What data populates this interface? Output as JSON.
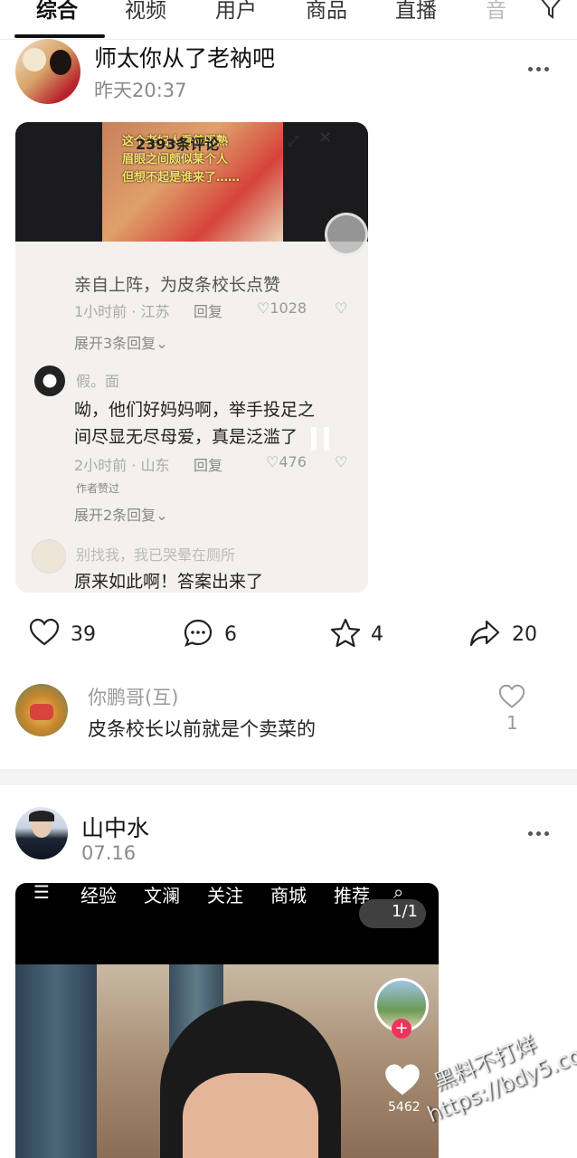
{
  "tabs": [
    {
      "label": "综合",
      "active": true
    },
    {
      "label": "视频"
    },
    {
      "label": "用户"
    },
    {
      "label": "商品"
    },
    {
      "label": "直播"
    },
    {
      "label": "音"
    }
  ],
  "post1": {
    "username": "师太你从了老衲吧",
    "time": "昨天20:37",
    "video_captions": [
      "这个老妇人看着眼熟",
      "眉眼之间颇似某个人",
      "但想不起是谁来了……"
    ],
    "panel_title": "2393条评论",
    "comments": [
      {
        "text": "亲自上阵，为皮条校长点赞",
        "time_location": "1小时前 · 江苏",
        "reply_label": "回复",
        "likes": "1028",
        "expand": "展开3条回复"
      },
      {
        "name": "假。面",
        "text_line1": "呦，他们好妈妈啊，举手投足之",
        "text_line2": "间尽显无尽母爱，真是泛滥了",
        "time_location": "2小时前 · 山东",
        "reply_label": "回复",
        "likes": "476",
        "author_liked": "作者赞过",
        "expand": "展开2条回复"
      },
      {
        "name": "别找我，我已哭晕在厕所",
        "text": "原来如此啊！答案出来了"
      }
    ],
    "actions": {
      "likes": "39",
      "comments": "6",
      "favorites": "4",
      "shares": "20"
    },
    "preview_comment": {
      "name": "你鹏哥(互)",
      "text": "皮条校长以前就是个卖菜的",
      "likes": "1"
    }
  },
  "post2": {
    "username": "山中水",
    "time": "07.16",
    "video_nav": [
      "经验",
      "文澜",
      "关注",
      "商城",
      "推荐"
    ],
    "page_indicator": "1/1",
    "likes": "5462"
  },
  "watermark": {
    "line1": "黑料不打烊",
    "line2": "https://bdy5.co"
  }
}
